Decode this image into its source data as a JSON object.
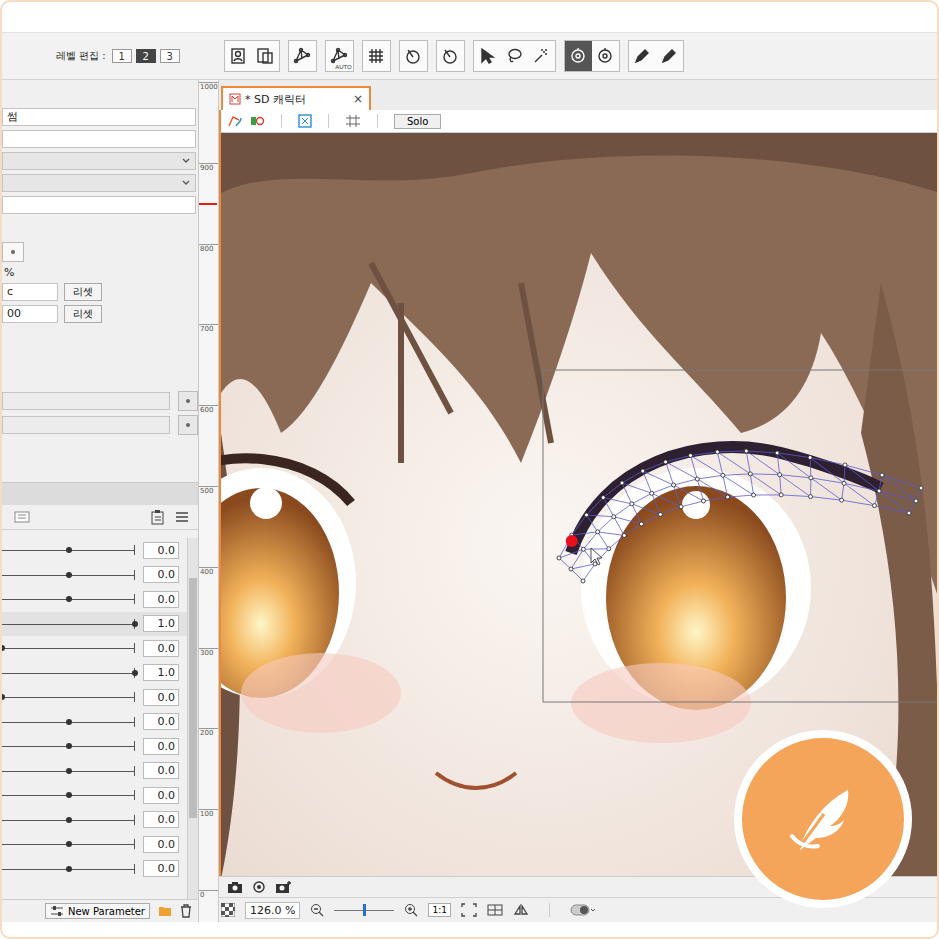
{
  "toolbar": {
    "level_label": "레벨 편집 :",
    "levels": [
      {
        "label": "1",
        "selected": false
      },
      {
        "label": "2",
        "selected": true
      },
      {
        "label": "3",
        "selected": false
      }
    ],
    "tool_groups": [
      {
        "tools": [
          {
            "selected": false
          },
          {
            "selected": false
          }
        ]
      },
      {
        "tools": [
          {
            "selected": false
          }
        ]
      },
      {
        "tools": [
          {
            "selected": false,
            "label": "AUTO"
          }
        ]
      },
      {
        "tools": [
          {
            "selected": false
          }
        ]
      },
      {
        "tools": [
          {
            "selected": false
          }
        ]
      },
      {
        "tools": [
          {
            "selected": false
          }
        ]
      },
      {
        "tools": [
          {
            "selected": false
          },
          {
            "selected": false
          },
          {
            "selected": false
          }
        ]
      },
      {
        "tools": [
          {
            "selected": true
          },
          {
            "selected": false
          }
        ]
      },
      {
        "tools": [
          {
            "selected": false
          },
          {
            "selected": false
          }
        ]
      }
    ]
  },
  "properties": {
    "name_value": "썸",
    "percent_label": "%",
    "reset_rows": [
      {
        "value": "c",
        "button": "리셋"
      },
      {
        "value": "00",
        "button": "리셋"
      }
    ]
  },
  "ruler": {
    "ticks": [
      "1000",
      "900",
      "800",
      "700",
      "600",
      "500",
      "400",
      "300",
      "200",
      "100",
      "0"
    ]
  },
  "document_tab": {
    "title": "* SD 캐릭터",
    "close": "×"
  },
  "canvas_toolbar": {
    "solo": "Solo"
  },
  "parameters": {
    "rows": [
      {
        "value": "0.0",
        "level": 0.5,
        "selected": false
      },
      {
        "value": "0.0",
        "level": 0.5,
        "selected": false
      },
      {
        "value": "0.0",
        "level": 0.5,
        "selected": false
      },
      {
        "value": "1.0",
        "level": 1,
        "selected": true
      },
      {
        "value": "0.0",
        "level": 0,
        "selected": false
      },
      {
        "value": "1.0",
        "level": 1,
        "selected": false
      },
      {
        "value": "0.0",
        "level": 0,
        "selected": false
      },
      {
        "value": "0.0",
        "level": 0.5,
        "selected": false
      },
      {
        "value": "0.0",
        "level": 0.5,
        "selected": false
      },
      {
        "value": "0.0",
        "level": 0.5,
        "selected": false
      },
      {
        "value": "0.0",
        "level": 0.5,
        "selected": false
      },
      {
        "value": "0.0",
        "level": 0.5,
        "selected": false
      },
      {
        "value": "0.0",
        "level": 0.5,
        "selected": false
      },
      {
        "value": "0.0",
        "level": 0.5,
        "selected": false
      }
    ],
    "new_button": "New Parameter"
  },
  "status_bar": {
    "zoom": "126.0 %",
    "zoom_level": 0.5,
    "one_to_one": "1:1"
  }
}
